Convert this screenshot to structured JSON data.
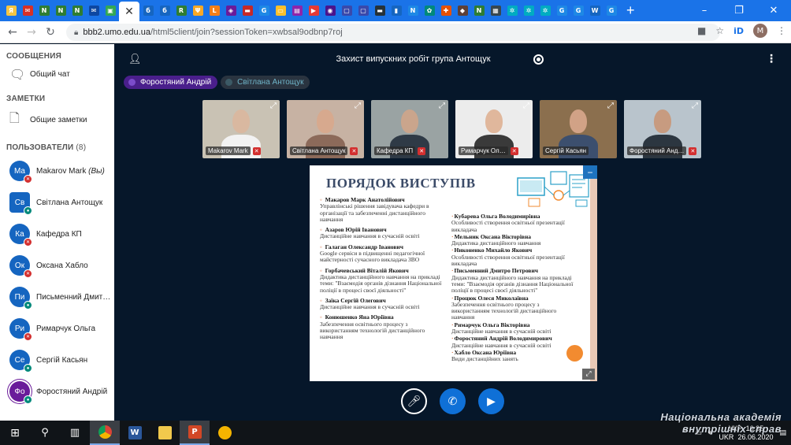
{
  "browser": {
    "active_tab_close": "✕",
    "new_tab": "+",
    "url_host": "bbb2.umo.edu.ua",
    "url_path": "/html5client/join?sessionToken=xwbsal9odbnp7roj",
    "profile_letter": "M",
    "ext_label": "iD",
    "tabs": [
      {
        "icon": "yandex",
        "color": "#f5c542",
        "glyph": "Я"
      },
      {
        "icon": "gmail",
        "color": "#d93025",
        "glyph": "✉"
      },
      {
        "icon": "ne",
        "color": "#2e7d32",
        "glyph": "N"
      },
      {
        "icon": "ne",
        "color": "#2e7d32",
        "glyph": "N"
      },
      {
        "icon": "ne",
        "color": "#2e7d32",
        "glyph": "N"
      },
      {
        "icon": "mail",
        "color": "#0d47a1",
        "glyph": "✉"
      },
      {
        "icon": "classroom",
        "color": "#34a853",
        "glyph": "▣"
      }
    ],
    "tabs_right": [
      {
        "color": "#1565c0",
        "glyph": "б"
      },
      {
        "color": "#1565c0",
        "glyph": "б"
      },
      {
        "color": "#2e7d32",
        "glyph": "R"
      },
      {
        "color": "#f9a825",
        "glyph": "Ψ"
      },
      {
        "color": "#f57f17",
        "glyph": "L"
      },
      {
        "color": "#6a1b9a",
        "glyph": "◈"
      },
      {
        "color": "#c62828",
        "glyph": "▬"
      },
      {
        "color": "#1e88e5",
        "glyph": "G"
      },
      {
        "color": "#fbc02d",
        "glyph": "▭"
      },
      {
        "color": "#8e24aa",
        "glyph": "▤"
      },
      {
        "color": "#e53935",
        "glyph": "▶"
      },
      {
        "color": "#4a148c",
        "glyph": "◉"
      },
      {
        "color": "#3949ab",
        "glyph": "▢"
      },
      {
        "color": "#3949ab",
        "glyph": "▢"
      },
      {
        "color": "#263238",
        "glyph": "▬"
      },
      {
        "color": "#1565c0",
        "glyph": "▮"
      },
      {
        "color": "#1e88e5",
        "glyph": "N"
      },
      {
        "color": "#00897b",
        "glyph": "✿"
      },
      {
        "color": "#e65100",
        "glyph": "✚"
      },
      {
        "color": "#5d4037",
        "glyph": "◆"
      },
      {
        "color": "#2e7d32",
        "glyph": "N"
      },
      {
        "color": "#37474f",
        "glyph": "▦"
      },
      {
        "color": "#00acc1",
        "glyph": "✲"
      },
      {
        "color": "#00acc1",
        "glyph": "✲"
      },
      {
        "color": "#00acc1",
        "glyph": "✲"
      },
      {
        "color": "#1e88e5",
        "glyph": "G"
      },
      {
        "color": "#1e88e5",
        "glyph": "G"
      },
      {
        "color": "#1565c0",
        "glyph": "W"
      },
      {
        "color": "#1e88e5",
        "glyph": "G"
      }
    ]
  },
  "sidebar": {
    "messages_title": "СООБЩЕНИЯ",
    "public_chat": "Общий чат",
    "notes_title": "ЗАМЕТКИ",
    "shared_notes": "Общие заметки",
    "users_title": "ПОЛЬЗОВАТЕЛИ",
    "users_count": "(8)",
    "users": [
      {
        "initials": "Ма",
        "name": "Makarov Mark",
        "you": "(Вы)",
        "color": "#1565c0",
        "badge": "#d32f2f",
        "badge_icon": "mic-off"
      },
      {
        "initials": "Св",
        "name": "Світлана Антощук",
        "you": "",
        "color": "#1565c0",
        "badge": "#00897b",
        "badge_icon": "headphones",
        "square": true
      },
      {
        "initials": "Ка",
        "name": "Кафедра КП",
        "you": "",
        "color": "#1565c0",
        "badge": "#d32f2f",
        "badge_icon": "mic-off"
      },
      {
        "initials": "Ок",
        "name": "Оксана Хабло",
        "you": "",
        "color": "#1565c0",
        "badge": "#d32f2f",
        "badge_icon": "mic-off"
      },
      {
        "initials": "Пи",
        "name": "Письменний Дмит…",
        "you": "",
        "color": "#1565c0",
        "badge": "#00897b",
        "badge_icon": "headphones"
      },
      {
        "initials": "Ри",
        "name": "Римарчук Ольга",
        "you": "",
        "color": "#1565c0",
        "badge": "#d32f2f",
        "badge_icon": "mic-off"
      },
      {
        "initials": "Се",
        "name": "Сергій Касьян",
        "you": "",
        "color": "#1565c0",
        "badge": "#00897b",
        "badge_icon": "headphones"
      },
      {
        "initials": "Фо",
        "name": "Форостяний Андрій",
        "you": "",
        "color": "#6a1b9a",
        "badge": "#00897b",
        "badge_icon": "headphones"
      }
    ]
  },
  "meeting": {
    "title": "Захист випускних робіт група Антощук",
    "talkers": [
      {
        "name": "Форостяний Андрій",
        "active": true
      },
      {
        "name": "Світлана Антощук",
        "active": false
      }
    ],
    "videos": [
      {
        "name": "Makarov Mark",
        "bg": "#c9c2b4",
        "skin": "#d9b8a0",
        "cloth": "#f2f2f2"
      },
      {
        "name": "Світлана Антощук",
        "bg": "#c7b2a3",
        "skin": "#d7a98e",
        "cloth": "#8c6a5a"
      },
      {
        "name": "Кафедра КП",
        "bg": "#9aa3a3",
        "skin": "#caa58c",
        "cloth": "#2f3a46"
      },
      {
        "name": "Римарчук Ол…",
        "bg": "#ececec",
        "skin": "#e0b79c",
        "cloth": "#3a3a3a"
      },
      {
        "name": "Сергій Касьян",
        "bg": "#8b6f4e",
        "skin": "#d1a286",
        "cloth": "#3c4f6e"
      },
      {
        "name": "Форостяний Анд…",
        "bg": "#b9c4cc",
        "skin": "#c79b80",
        "cloth": "#2c3640"
      }
    ]
  },
  "slide": {
    "title": "ПОРЯДОК ВИСТУПІВ",
    "left": [
      {
        "name": "Макаров Марк Анатолійович",
        "text": "Управлінські рішення завідувача кафедри в організації та забезпеченні дистанційного навчання"
      },
      {
        "name": "Азаров Юрій Іванович",
        "text": "Дистанційне навчання в сучасній освіті"
      },
      {
        "name": "Галаган Олександр Іванович",
        "text": "Google сервіси в підвищенні педагогічної майстерності сучасного викладача ЗВО"
      },
      {
        "name": "Горбачевський Віталій Якович",
        "text": "Дидактика дистанційного навчання на прикладі теми: \"Взаємодія органів дізнання Національної поліції в процесі своєї діяльності\""
      },
      {
        "name": "Заїка Сергій Олегович",
        "text": "Дистанційне навчання в сучасній освіті"
      },
      {
        "name": "Конюшенко Яна Юріївна",
        "text": "Забезпечення освітнього процесу з використанням технологій дистанційного навчання"
      }
    ],
    "right": [
      {
        "name": "Кубарева Ольга Володимирівна",
        "text": "Особливості створення освітньої презентації викладача"
      },
      {
        "name": "Мельник Оксана Вікторівна",
        "text": "Дидактика дистанційного навчання"
      },
      {
        "name": "Никоненко Михайло Якович",
        "text": "Особливості створення освітньої презентації викладача"
      },
      {
        "name": "Письменний Дмитро Петрович",
        "text": "Дидактика дистанційного навчання на прикладі теми: \"Взаємодія органів дізнання Національної поліції в процесі своєї діяльності\""
      },
      {
        "name": "Процюк Олеся Миколаївна",
        "text": "Забезпечення освітнього процесу з використанням технологій дистанційного навчання"
      },
      {
        "name": "Римарчук Ольга Вікторівна",
        "text": "Дистанційне навчання в сучасній освіті"
      },
      {
        "name": "Форостяний Андрій Володимирович",
        "text": "Дистанційне навчання в сучасній освіті"
      },
      {
        "name": "Хабло Оксана Юріївна",
        "text": "Види дистанційних занять"
      }
    ]
  },
  "taskbar": {
    "lang": "УКР",
    "lang2": "UKR",
    "time": "16:35",
    "date": "26.06.2020"
  },
  "watermark": {
    "line1": "Національна академія",
    "line2": "внутрішніх справ"
  },
  "colors": {
    "chrome_blue": "#1a73e8",
    "meeting_bg": "#06172a",
    "talker_active": "#4a1f8c",
    "control_blue": "#0f70d7",
    "slide_title": "#3b4b68",
    "slide_accent": "#d2693a"
  }
}
